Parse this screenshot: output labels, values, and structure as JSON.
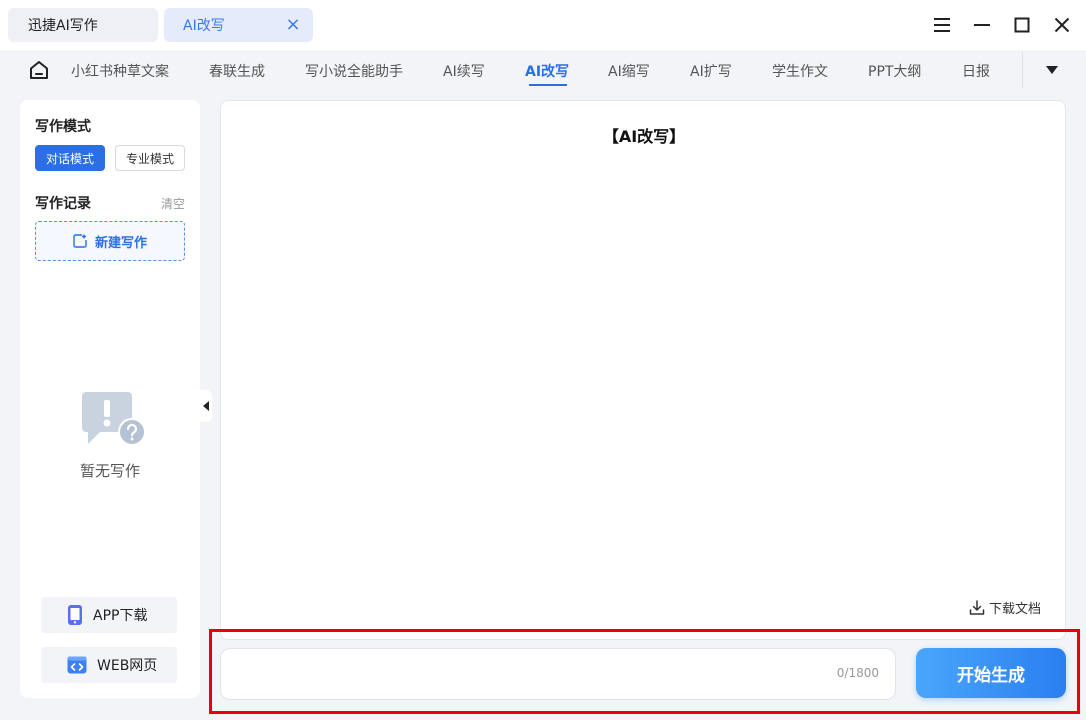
{
  "titlebar": {
    "tabs": [
      {
        "label": "迅捷AI写作"
      },
      {
        "label": "AI改写"
      }
    ],
    "close_glyph": "×"
  },
  "nav": {
    "items": [
      {
        "label": "小红书种草文案"
      },
      {
        "label": "春联生成"
      },
      {
        "label": "写小说全能助手"
      },
      {
        "label": "AI续写"
      },
      {
        "label": "AI改写",
        "active": true
      },
      {
        "label": "AI缩写"
      },
      {
        "label": "AI扩写"
      },
      {
        "label": "学生作文"
      },
      {
        "label": "PPT大纲"
      },
      {
        "label": "日报"
      }
    ]
  },
  "sidebar": {
    "mode_title": "写作模式",
    "mode_chat": "对话模式",
    "mode_pro": "专业模式",
    "record_title": "写作记录",
    "clear": "清空",
    "new_write": "新建写作",
    "empty_text": "暂无写作",
    "app_download": "APP下载",
    "web_page": "WEB网页"
  },
  "main": {
    "doc_title": "【AI改写】",
    "download": "下载文档"
  },
  "input": {
    "value": "",
    "counter": "0/1800",
    "start_button": "开始生成"
  },
  "colors": {
    "accent": "#2a6fe3",
    "highlight": "#e60012"
  }
}
